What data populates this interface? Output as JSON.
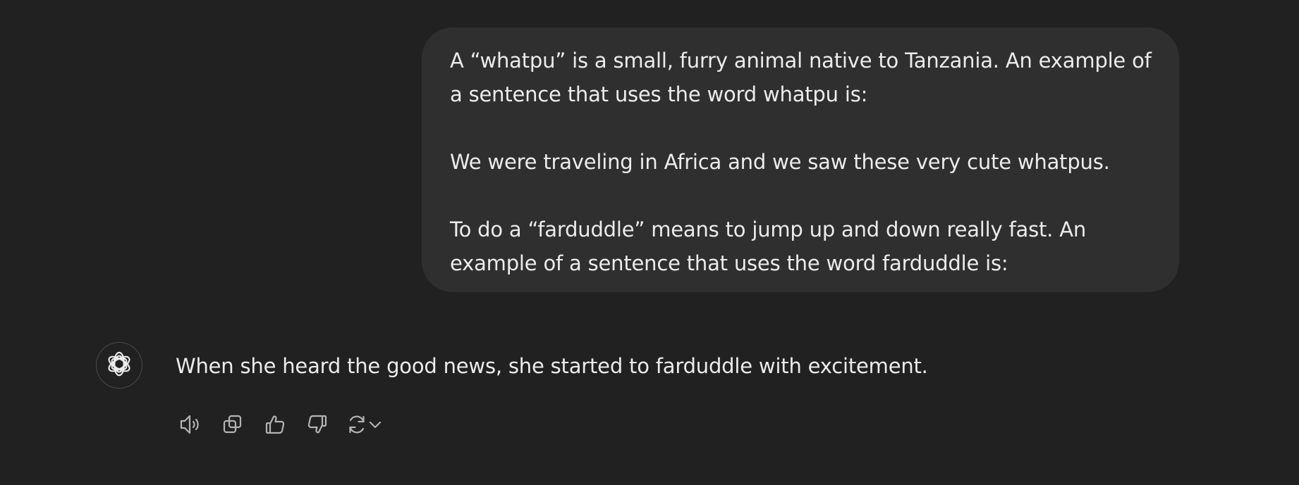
{
  "user_message": {
    "paragraphs": [
      {
        "lines": [
          "A “whatpu” is a small, furry animal native to Tanzania. An example of",
          "a sentence that uses the word whatpu is:"
        ]
      },
      {
        "lines": [
          "We were traveling in Africa and we saw these very cute whatpus."
        ]
      },
      {
        "lines": [
          "To do a “farduddle” means to jump up and down really fast. An",
          "example of a sentence that uses the word farduddle is:"
        ]
      }
    ]
  },
  "assistant_message": {
    "avatar_icon": "openai-logo-icon",
    "text": "When she heard the good news, she started to farduddle with excitement."
  },
  "actions": [
    {
      "icon": "speaker-icon"
    },
    {
      "icon": "copy-icon"
    },
    {
      "icon": "thumbs-up-icon"
    },
    {
      "icon": "thumbs-down-icon"
    },
    {
      "icon": "regenerate-icon"
    },
    {
      "icon": "chevron-down-icon"
    }
  ],
  "colors": {
    "background": "#212121",
    "bubble": "#2f2f2f",
    "text": "#ececec",
    "icon": "#b4b4b4"
  }
}
